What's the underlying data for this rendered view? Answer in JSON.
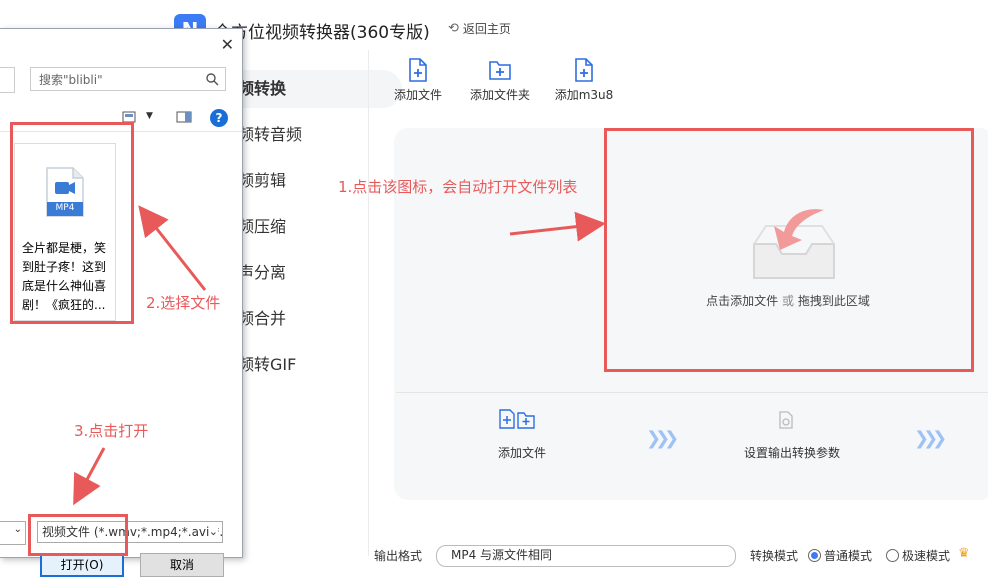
{
  "app": {
    "title": "全方位视频转换器(360专版)",
    "back_home": "返回主页"
  },
  "sidebar": {
    "items": [
      {
        "label": "视频转换"
      },
      {
        "label": "视频转音频"
      },
      {
        "label": "视频剪辑"
      },
      {
        "label": "视频压缩"
      },
      {
        "label": "人声分离"
      },
      {
        "label": "视频合并"
      },
      {
        "label": "视频转GIF"
      }
    ]
  },
  "toolbar": {
    "add_file": "添加文件",
    "add_folder": "添加文件夹",
    "add_m3u8": "添加m3u8"
  },
  "dropzone": {
    "hint_a": "点击添加文件",
    "hint_or": "或",
    "hint_b": "拖拽到此区域"
  },
  "steps": {
    "step1": "添加文件",
    "step2": "设置输出转换参数"
  },
  "bottom": {
    "output_format_label": "输出格式",
    "output_format_value": "MP4 与源文件相同",
    "convert_mode_label": "转换模式",
    "mode_normal": "普通模式",
    "mode_fast": "极速模式"
  },
  "dialog": {
    "search_placeholder": "搜索\"blibli\"",
    "file_badge": "MP4",
    "file_name": "全片都是梗，笑到肚子疼！这到底是什么神仙喜剧！《疯狂的...",
    "filetype_value": "视频文件 (*.wmv;*.mp4;*.avi;*.",
    "open_button": "打开(O)",
    "cancel_button": "取消"
  },
  "annotations": {
    "step1": "1.点击该图标，会自动打开文件列表",
    "step2": "2.选择文件",
    "step3": "3.点击打开"
  },
  "colors": {
    "accent": "#3b7bf6",
    "annotation": "#e85a5a",
    "dialog_primary": "#1a6fd6"
  }
}
